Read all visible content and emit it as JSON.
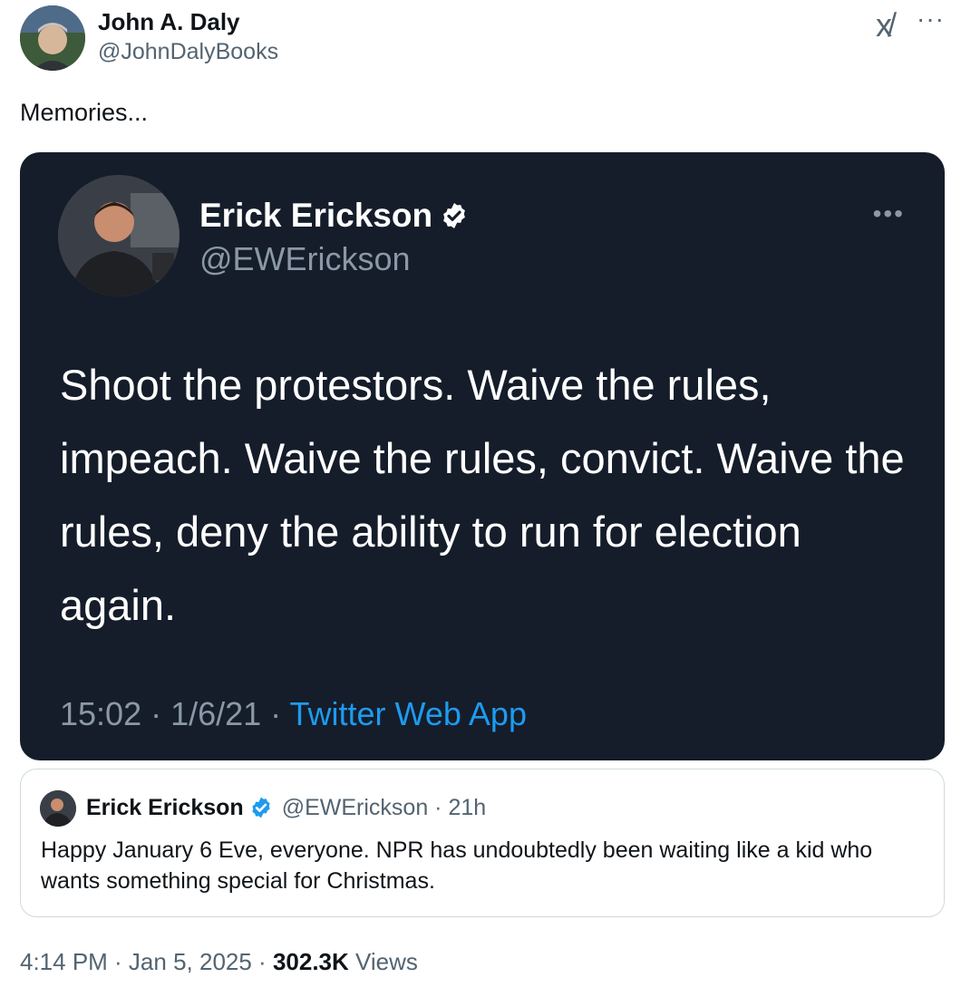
{
  "author": {
    "name": "John A. Daly",
    "handle": "@JohnDalyBooks"
  },
  "header": {
    "logo_text": "x̸",
    "more_glyph": "···"
  },
  "tweet": {
    "text": "Memories..."
  },
  "media": {
    "name": "Erick Erickson",
    "handle": "@EWErickson",
    "more_glyph": "•••",
    "text": "Shoot the protestors.  Waive the rules, impeach.  Waive the rules, convict. Waive the rules, deny the ability to run for election again.",
    "time": "15:02 · 1/6/21 · ",
    "app": "Twitter Web App"
  },
  "quote": {
    "name": "Erick Erickson",
    "handle": "@EWErickson · 21h",
    "text": "Happy January 6 Eve, everyone. NPR has undoubtedly been waiting like a kid who wants something special for Christmas."
  },
  "footer": {
    "time": "4:14 PM · Jan 5, 2025 · ",
    "views_count": "302.3K",
    "views_label": " Views"
  },
  "colors": {
    "verified": "#1d9bf0",
    "media_bg": "#151d2a",
    "secondary_text": "#536471"
  },
  "icons": {
    "verified": "verified-badge-icon",
    "logo": "x-logo-icon",
    "more": "more-options-icon"
  }
}
